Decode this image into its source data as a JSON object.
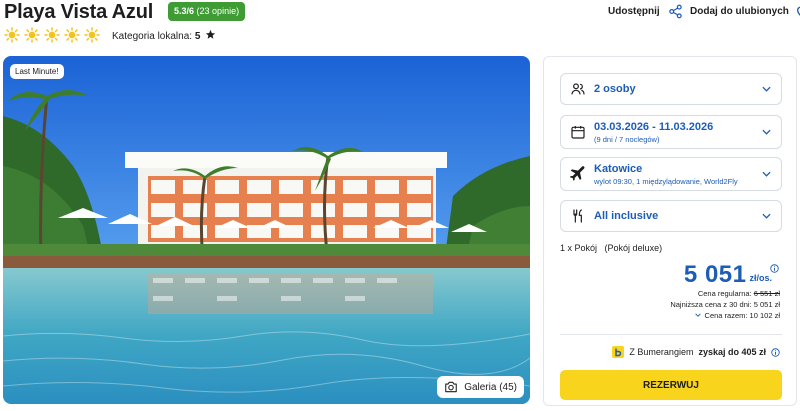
{
  "hotel": {
    "name": "Playa Vista Azul",
    "rating_score": "5.3/6",
    "rating_count": "(23 opinie)",
    "sun_rating": 5,
    "category_label": "Kategoria lokalna:",
    "category_value": "5"
  },
  "header_actions": {
    "share_label": "Udostępnij",
    "favorite_label": "Dodaj do ulubionych"
  },
  "photo": {
    "badge": "Last Minute!",
    "gallery_label": "Galeria (45)"
  },
  "booking": {
    "guests": {
      "main": "2 osoby",
      "icon": "people-icon"
    },
    "dates": {
      "main": "03.03.2026 - 11.03.2026",
      "sub": "(9 dni / 7 noclegów)",
      "icon": "calendar-icon"
    },
    "flight": {
      "main": "Katowice",
      "sub": "wylot 09:30, 1 międzylądowanie, World2Fly",
      "icon": "plane-icon"
    },
    "board": {
      "main": "All inclusive",
      "icon": "cutlery-icon"
    },
    "room_qty": "1 x Pokój",
    "room_type": "(Pokój deluxe)",
    "price": "5 051",
    "price_unit": "zł/os.",
    "regular_label": "Cena regularna:",
    "regular_value": "6 551 zł",
    "lowest_text": "Najniższa cena z 30 dni: 5 051 zł",
    "total_text": "Cena razem: 10 102 zł",
    "bumerang_prefix": "Z Bumerangiem",
    "bumerang_bold": "zyskaj do 405 zł",
    "reserve_label": "REZERWUJ"
  },
  "colors": {
    "accent_blue": "#1d5db5",
    "rating_green": "#3f9c35",
    "sun_yellow": "#f6c21c",
    "reserve_yellow": "#f8d41c"
  }
}
